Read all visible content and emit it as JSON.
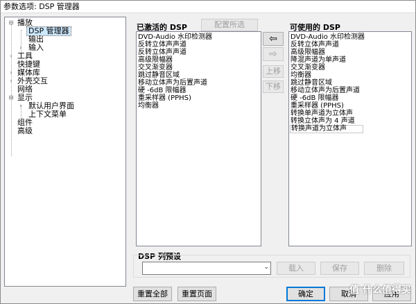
{
  "window": {
    "title": "参数选项: DSP 管理器"
  },
  "tree": {
    "items": [
      {
        "label": "播放",
        "toggle": "⊟"
      },
      {
        "label": "DSP 管理器"
      },
      {
        "label": "输出"
      },
      {
        "label": "输入",
        "toggle": "›"
      },
      {
        "label": "工具",
        "toggle": "›"
      },
      {
        "label": "快捷键"
      },
      {
        "label": "媒体库",
        "toggle": "›"
      },
      {
        "label": "外壳交互",
        "toggle": "›"
      },
      {
        "label": "网络"
      },
      {
        "label": "显示",
        "toggle": "⊟"
      },
      {
        "label": "默认用户界面",
        "toggle": "›"
      },
      {
        "label": "上下文菜单"
      },
      {
        "label": "组件"
      },
      {
        "label": "高级"
      }
    ]
  },
  "active": {
    "label": "已激活的 DSP",
    "configure_button": "配置所选",
    "items": [
      "DVD-Audio 水印检测器",
      "反转立体声声道",
      "反转立体声声道",
      "高级限幅器",
      "交叉渐变器",
      "跳过静音区域",
      "移动立体声为后置声道",
      "硬 -6dB 限幅器",
      "重采样器 (PPHS)",
      "均衡器"
    ]
  },
  "move": {
    "add": "⇦",
    "remove": "⇨",
    "up": "上移",
    "down": "下移"
  },
  "available": {
    "label": "可使用的 DSP",
    "items": [
      "DVD-Audio 水印检测器",
      "反转立体声声道",
      "高级限幅器",
      "降混声道为单声道",
      "交叉渐变器",
      "均衡器",
      "跳过静音区域",
      "移动立体声为后置声道",
      "硬 -6dB 限幅器",
      "重采样器 (PPHS)",
      "转换单声道为立体声",
      "转换立体声为 4 声道",
      "转换声道为立体声"
    ]
  },
  "presets": {
    "label": "DSP 列预设",
    "combo_value": "",
    "load": "载入",
    "save": "保存",
    "delete": "删除"
  },
  "footer": {
    "reset_all": "重置全部",
    "reset_page": "重置页面",
    "ok": "确定",
    "cancel": "取消",
    "apply": "应用"
  },
  "watermark": "值 什么值得买"
}
